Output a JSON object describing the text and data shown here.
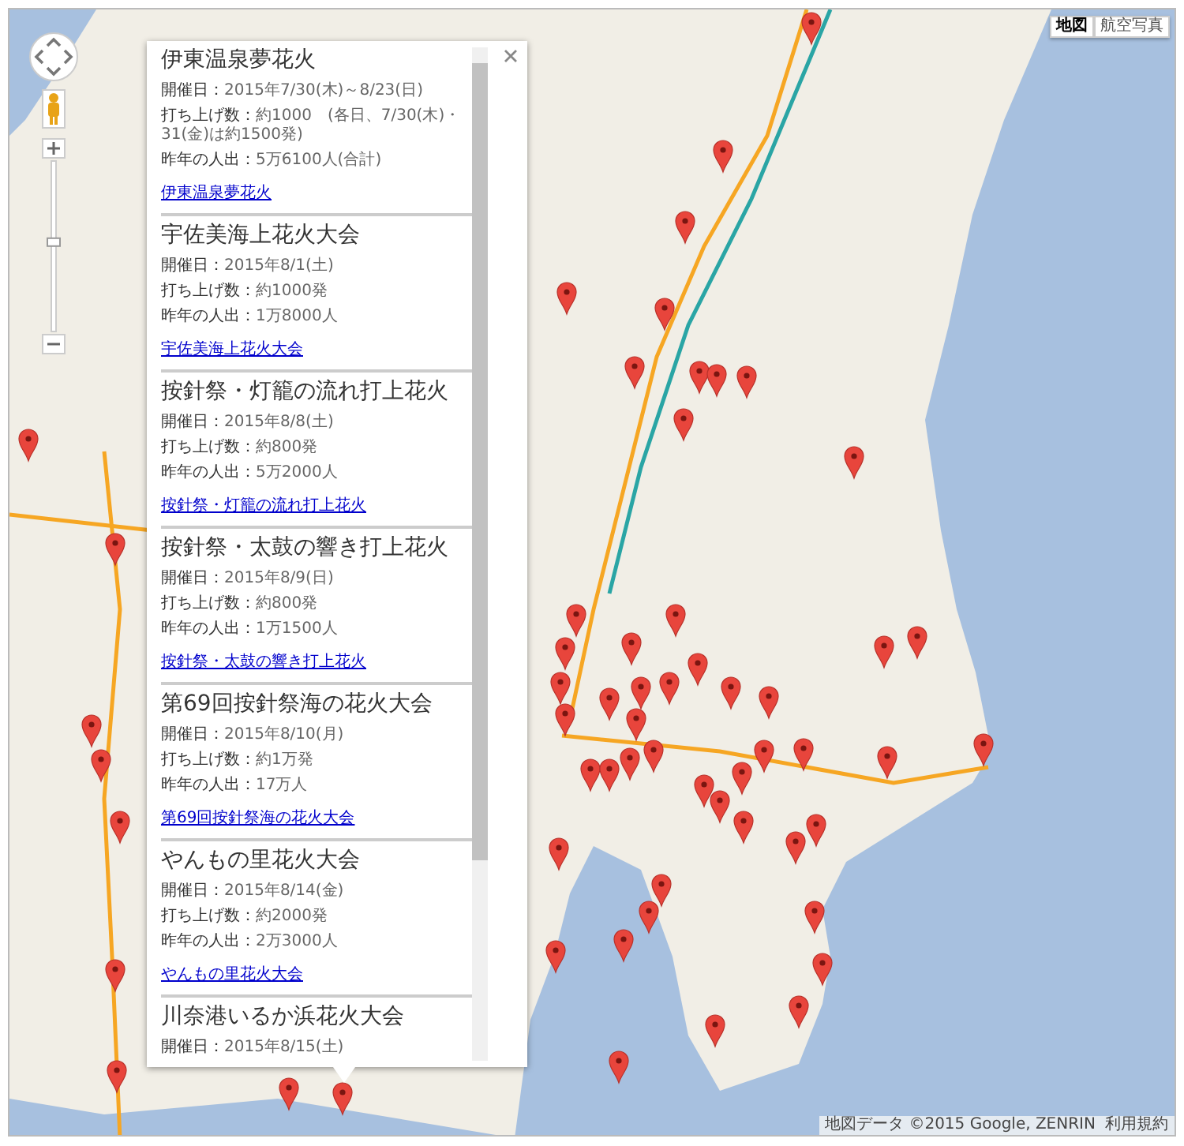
{
  "map_controls": {
    "zoom": {
      "level": 0.55
    }
  },
  "map_type_buttons": [
    {
      "label": "地図",
      "selected": true
    },
    {
      "label": "航空写真",
      "selected": false
    }
  ],
  "info_window": {
    "entries": [
      {
        "title": "伊東温泉夢花火",
        "details": [
          {
            "label": "開催日：",
            "value": "2015年7/30(木)～8/23(日)"
          },
          {
            "label": "打ち上げ数：",
            "value": "約1000　(各日、7/30(木)・31(金)は約1500発)"
          },
          {
            "label": "昨年の人出：",
            "value": "5万6100人(合計)"
          }
        ],
        "link": "伊東温泉夢花火"
      },
      {
        "title": "宇佐美海上花火大会",
        "details": [
          {
            "label": "開催日：",
            "value": "2015年8/1(土)"
          },
          {
            "label": "打ち上げ数：",
            "value": "約1000発"
          },
          {
            "label": "昨年の人出：",
            "value": "1万8000人"
          }
        ],
        "link": "宇佐美海上花火大会"
      },
      {
        "title": "按針祭・灯籠の流れ打上花火",
        "details": [
          {
            "label": "開催日：",
            "value": "2015年8/8(土)"
          },
          {
            "label": "打ち上げ数：",
            "value": "約800発"
          },
          {
            "label": "昨年の人出：",
            "value": "5万2000人"
          }
        ],
        "link": "按針祭・灯籠の流れ打上花火"
      },
      {
        "title": "按針祭・太鼓の響き打上花火",
        "details": [
          {
            "label": "開催日：",
            "value": "2015年8/9(日)"
          },
          {
            "label": "打ち上げ数：",
            "value": "約800発"
          },
          {
            "label": "昨年の人出：",
            "value": "1万1500人"
          }
        ],
        "link": "按針祭・太鼓の響き打上花火"
      },
      {
        "title": "第69回按針祭海の花火大会",
        "details": [
          {
            "label": "開催日：",
            "value": "2015年8/10(月)"
          },
          {
            "label": "打ち上げ数：",
            "value": "約1万発"
          },
          {
            "label": "昨年の人出：",
            "value": "17万人"
          }
        ],
        "link": "第69回按針祭海の花火大会"
      },
      {
        "title": "やんもの里花火大会",
        "details": [
          {
            "label": "開催日：",
            "value": "2015年8/14(金)"
          },
          {
            "label": "打ち上げ数：",
            "value": "約2000発"
          },
          {
            "label": "昨年の人出：",
            "value": "2万3000人"
          }
        ],
        "link": "やんもの里花火大会"
      },
      {
        "title": "川奈港いるか浜花火大会",
        "details": [
          {
            "label": "開催日：",
            "value": "2015年8/15(土)"
          }
        ]
      }
    ]
  },
  "attribution": {
    "text": "地図データ ©2015 Google, ZENRIN",
    "terms_link": "利用規約"
  }
}
